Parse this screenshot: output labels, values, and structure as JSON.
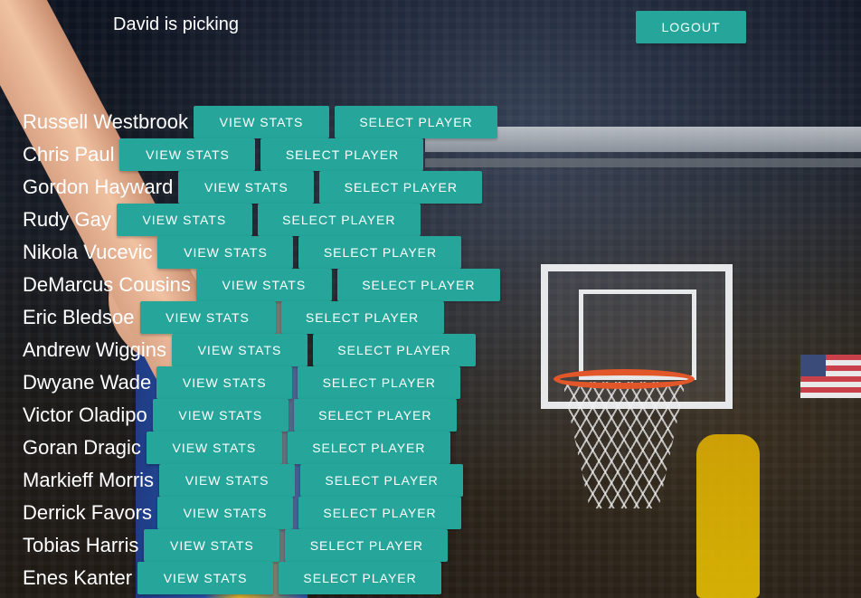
{
  "header": {
    "status_text": "David is picking",
    "logout_label": "LOGOUT"
  },
  "players": [
    {
      "name": "Russell Westbrook",
      "view_stats_label": "VIEW STATS",
      "select_label": "SELECT PLAYER"
    },
    {
      "name": "Chris Paul",
      "view_stats_label": "VIEW STATS",
      "select_label": "SELECT PLAYER"
    },
    {
      "name": "Gordon Hayward",
      "view_stats_label": "VIEW STATS",
      "select_label": "SELECT PLAYER"
    },
    {
      "name": "Rudy Gay",
      "view_stats_label": "VIEW STATS",
      "select_label": "SELECT PLAYER"
    },
    {
      "name": "Nikola Vucevic",
      "view_stats_label": "VIEW STATS",
      "select_label": "SELECT PLAYER"
    },
    {
      "name": "DeMarcus Cousins",
      "view_stats_label": "VIEW STATS",
      "select_label": "SELECT PLAYER"
    },
    {
      "name": "Eric Bledsoe",
      "view_stats_label": "VIEW STATS",
      "select_label": "SELECT PLAYER"
    },
    {
      "name": "Andrew Wiggins",
      "view_stats_label": "VIEW STATS",
      "select_label": "SELECT PLAYER"
    },
    {
      "name": "Dwyane Wade",
      "view_stats_label": "VIEW STATS",
      "select_label": "SELECT PLAYER"
    },
    {
      "name": "Victor Oladipo",
      "view_stats_label": "VIEW STATS",
      "select_label": "SELECT PLAYER"
    },
    {
      "name": "Goran Dragic",
      "view_stats_label": "VIEW STATS",
      "select_label": "SELECT PLAYER"
    },
    {
      "name": "Markieff Morris",
      "view_stats_label": "VIEW STATS",
      "select_label": "SELECT PLAYER"
    },
    {
      "name": "Derrick Favors",
      "view_stats_label": "VIEW STATS",
      "select_label": "SELECT PLAYER"
    },
    {
      "name": "Tobias Harris",
      "view_stats_label": "VIEW STATS",
      "select_label": "SELECT PLAYER"
    },
    {
      "name": "Enes Kanter",
      "view_stats_label": "VIEW STATS",
      "select_label": "SELECT PLAYER"
    }
  ],
  "theme": {
    "button_color": "#26a69a",
    "text_color": "#ffffff"
  }
}
